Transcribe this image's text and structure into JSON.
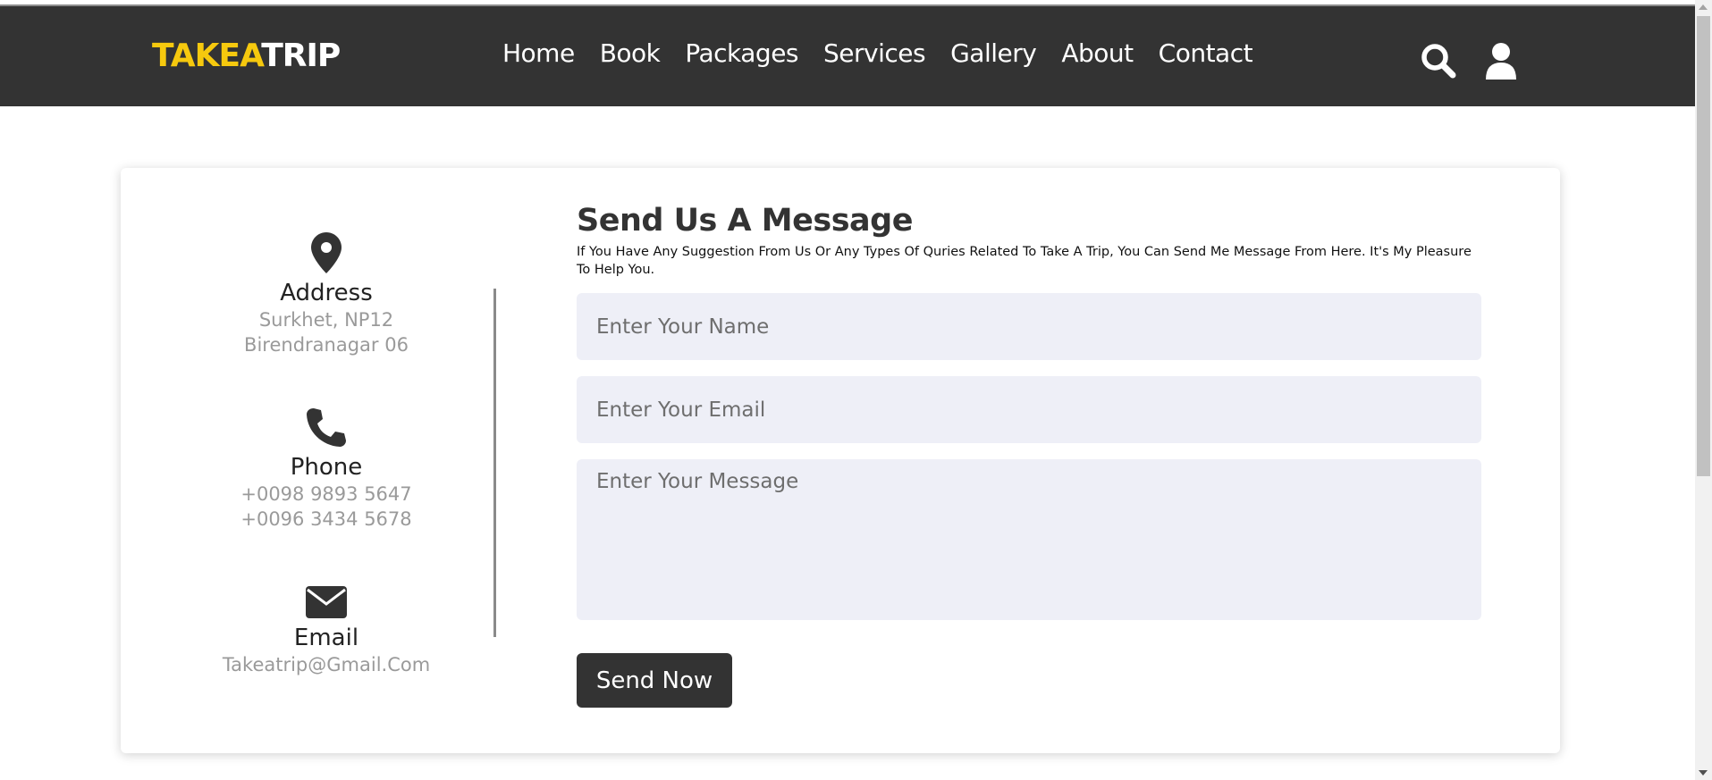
{
  "brand": {
    "part1": "TAKEA",
    "part2": "TRIP",
    "accent_color": "#f6c90e"
  },
  "nav": {
    "items": [
      "Home",
      "Book",
      "Packages",
      "Services",
      "Gallery",
      "About",
      "Contact"
    ]
  },
  "header_icons": {
    "search": "search-icon",
    "user": "user-icon"
  },
  "contact_info": {
    "address": {
      "icon": "map-pin-icon",
      "title": "Address",
      "lines": [
        "Surkhet, NP12",
        "Birendranagar 06"
      ]
    },
    "phone": {
      "icon": "phone-icon",
      "title": "Phone",
      "lines": [
        "+0098 9893 5647",
        "+0096 3434 5678"
      ]
    },
    "email": {
      "icon": "envelope-icon",
      "title": "Email",
      "lines": [
        "Takeatrip@Gmail.Com"
      ]
    }
  },
  "form": {
    "title": "Send Us A Message",
    "description": "If You Have Any Suggestion From Us Or Any Types Of Quries Related To Take A Trip, You Can Send Me Message From Here. It's My Pleasure To Help You.",
    "name_placeholder": "Enter Your Name",
    "email_placeholder": "Enter Your Email",
    "message_placeholder": "Enter Your Message",
    "submit_label": "Send Now"
  }
}
